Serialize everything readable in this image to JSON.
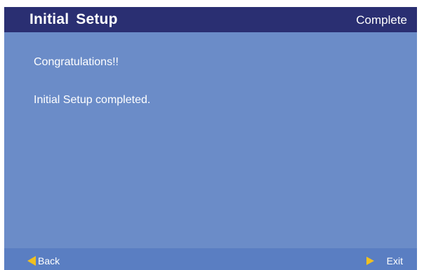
{
  "header": {
    "title": "Initial  Setup",
    "status": "Complete"
  },
  "main": {
    "line1": "Congratulations!!",
    "line2": "Initial Setup completed."
  },
  "footer": {
    "back_label": "Back",
    "back_icon": "left-arrow-icon",
    "exit_label": "Exit",
    "exit_icon": "right-arrow-icon"
  },
  "colors": {
    "header_bg": "#2a2f72",
    "body_bg": "#6b8cc8",
    "footer_bg": "#5a7ec2",
    "arrow": "#f0c020"
  }
}
